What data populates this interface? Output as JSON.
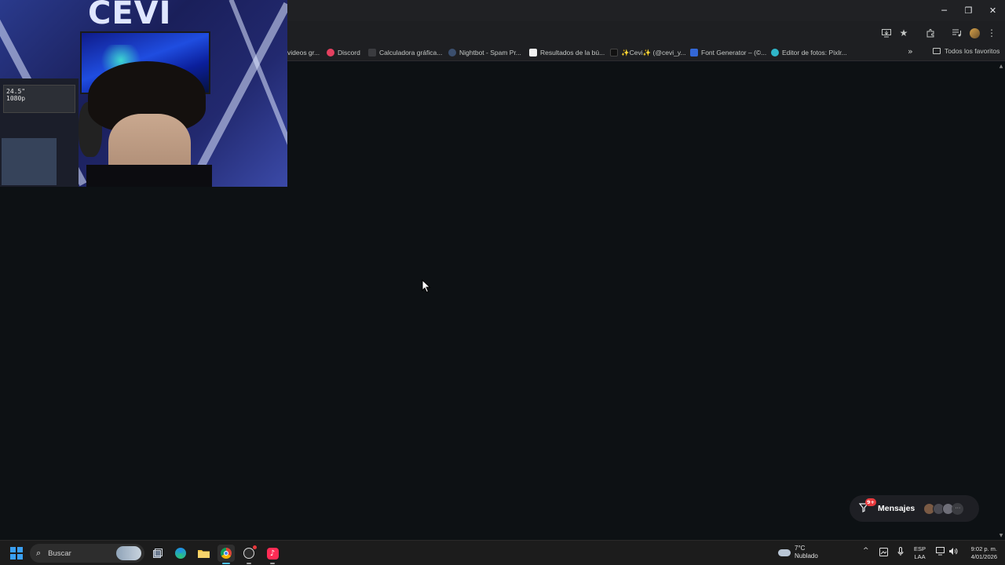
{
  "window_controls": {
    "minimize": "─",
    "restore": "❐",
    "close": "✕"
  },
  "toolbar": {
    "icons": [
      "install-icon",
      "star-icon",
      "extensions-icon",
      "media-icon",
      "profile-icon",
      "menu-icon"
    ]
  },
  "bookmarks": {
    "items": [
      {
        "label": "videos gr...",
        "favicon_color": "#1e1f22"
      },
      {
        "label": "Discord",
        "favicon_color": "#e4405f"
      },
      {
        "label": "Calculadora gráfica...",
        "favicon_color": "#3a3b3f"
      },
      {
        "label": "Nightbot - Spam Pr...",
        "favicon_color": "#3b4f6e"
      },
      {
        "label": "Resultados de la bú...",
        "favicon_color": "#f1f1f1"
      },
      {
        "label": "✨Cevi✨ (@cevi_y...",
        "favicon_color": "#111111"
      },
      {
        "label": "Font Generator – (©...",
        "favicon_color": "#3367d6"
      },
      {
        "label": "Editor de fotos: Pixlr...",
        "favicon_color": "#2fb6c9"
      }
    ],
    "overflow": "»",
    "all_bookmarks": "Todos los favoritos"
  },
  "webcam": {
    "logo": "CEVI",
    "box_text": "24.5\"\n1080p"
  },
  "messages_widget": {
    "badge": "9+",
    "label": "Mensajes",
    "avatar_colors": [
      "#7a5a44",
      "#4a4a52",
      "#6e6e78"
    ]
  },
  "taskbar": {
    "search_placeholder": "Buscar",
    "apps": [
      "task-view",
      "edge",
      "file-explorer",
      "chrome",
      "obs",
      "tiktok"
    ],
    "weather": {
      "temp": "7°C",
      "condition": "Nublado"
    },
    "language": {
      "line1": "ESP",
      "line2": "LAA"
    },
    "clock": {
      "time": "9:02 p. m.",
      "date": "4/01/2026"
    }
  },
  "colors": {
    "page_bg": "#0d1114",
    "chrome_bg": "#1e1f22",
    "taskbar_bg": "#1c1c1c",
    "accent": "#4cc2ff"
  }
}
